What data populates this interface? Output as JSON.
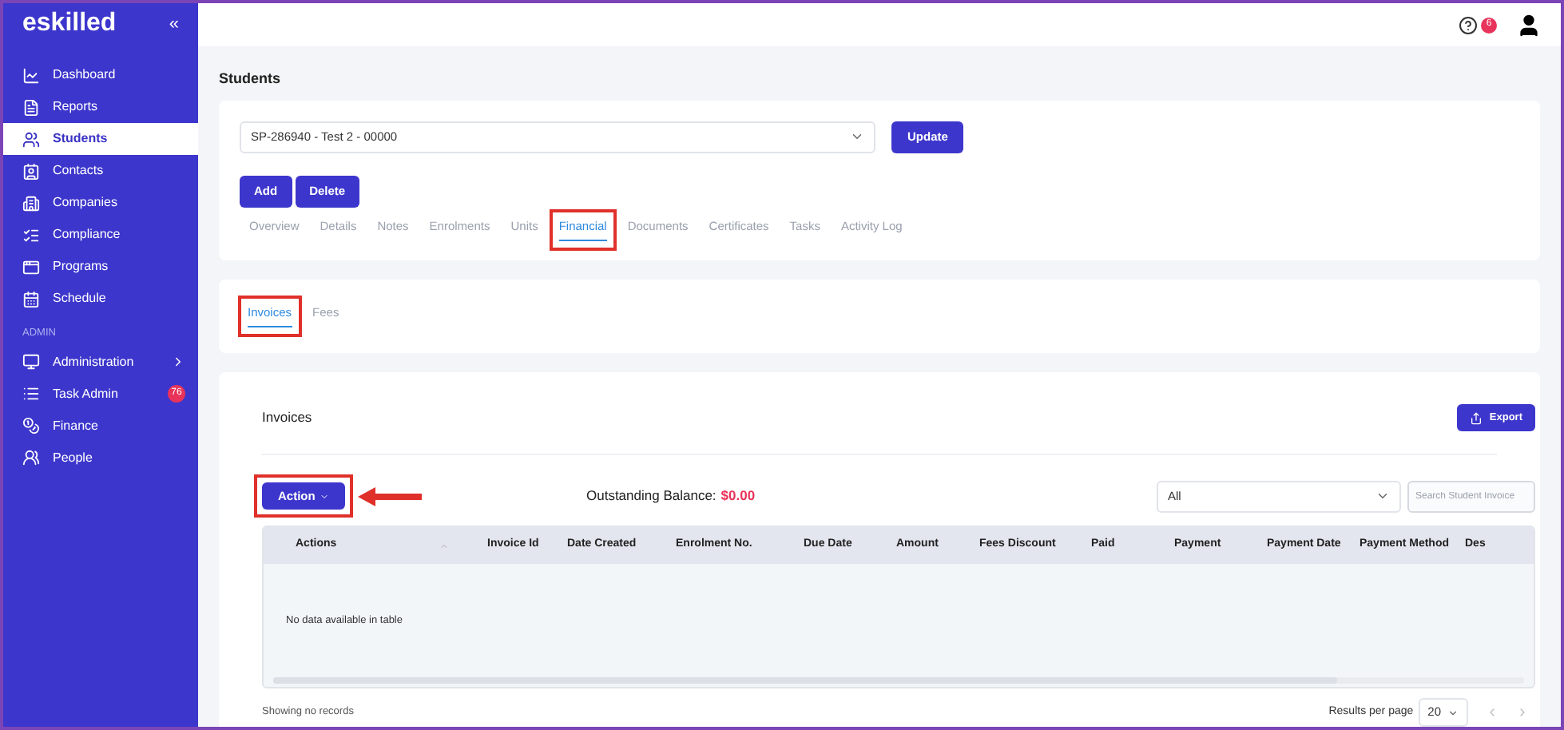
{
  "sidebar": {
    "logo": "eskilled",
    "collapse_glyph": "«",
    "items": [
      {
        "label": "Dashboard",
        "kind": "chart",
        "selected": false
      },
      {
        "label": "Reports",
        "kind": "report",
        "selected": false
      },
      {
        "label": "Students",
        "kind": "users",
        "selected": true
      },
      {
        "label": "Contacts",
        "kind": "contact",
        "selected": false
      },
      {
        "label": "Companies",
        "kind": "building",
        "selected": false
      },
      {
        "label": "Compliance",
        "kind": "list",
        "selected": false
      },
      {
        "label": "Programs",
        "kind": "window",
        "selected": false
      },
      {
        "label": "Schedule",
        "kind": "calendar",
        "selected": false
      }
    ],
    "section_label": "ADMIN",
    "admin_items": [
      {
        "label": "Administration",
        "kind": "monitor",
        "selected": false,
        "has_submenu": true
      },
      {
        "label": "Task Admin",
        "kind": "tasks",
        "selected": false,
        "badge": "76"
      },
      {
        "label": "Finance",
        "kind": "coins",
        "selected": false
      },
      {
        "label": "People",
        "kind": "people",
        "selected": false
      }
    ]
  },
  "header": {
    "notification_badge": "6"
  },
  "page_title": "Students",
  "student_select": {
    "value": "SP-286940 - Test 2 - 00000"
  },
  "update_button": "Update",
  "buttons": [
    "Add",
    "Delete"
  ],
  "tabs": [
    {
      "label": "Overview",
      "selected": false,
      "highlighted": false
    },
    {
      "label": "Details",
      "selected": false,
      "highlighted": false
    },
    {
      "label": "Notes",
      "selected": false,
      "highlighted": false
    },
    {
      "label": "Enrolments",
      "selected": false,
      "highlighted": false
    },
    {
      "label": "Units",
      "selected": false,
      "highlighted": false
    },
    {
      "label": "Financial",
      "selected": true,
      "highlighted": true
    },
    {
      "label": "Documents",
      "selected": false,
      "highlighted": false
    },
    {
      "label": "Certificates",
      "selected": false,
      "highlighted": false
    },
    {
      "label": "Tasks",
      "selected": false,
      "highlighted": false
    },
    {
      "label": "Activity Log",
      "selected": false,
      "highlighted": false
    }
  ],
  "sub_tabs": [
    {
      "label": "Invoices",
      "selected": true,
      "highlighted": true
    },
    {
      "label": "Fees",
      "selected": false,
      "highlighted": false
    }
  ],
  "invoices": {
    "title": "Invoices",
    "export_button": "Export",
    "action_button": {
      "label": "Action",
      "highlighted": true
    },
    "balance_label": "Outstanding Balance:",
    "balance_value": "$0.00",
    "filter_select": {
      "value": "All"
    },
    "search": {
      "placeholder": "Search Student Invoice"
    },
    "table": {
      "columns": [
        "Actions",
        "Invoice Id",
        "Date Created",
        "Enrolment No.",
        "Due Date",
        "Amount",
        "Fees Discount",
        "Paid",
        "Payment",
        "Payment Date",
        "Payment Method",
        "Des"
      ],
      "empty_message": "No data available in table"
    },
    "footer": {
      "records": "Showing no records",
      "per_page_label": "Results per page",
      "per_page_value": "20"
    }
  }
}
